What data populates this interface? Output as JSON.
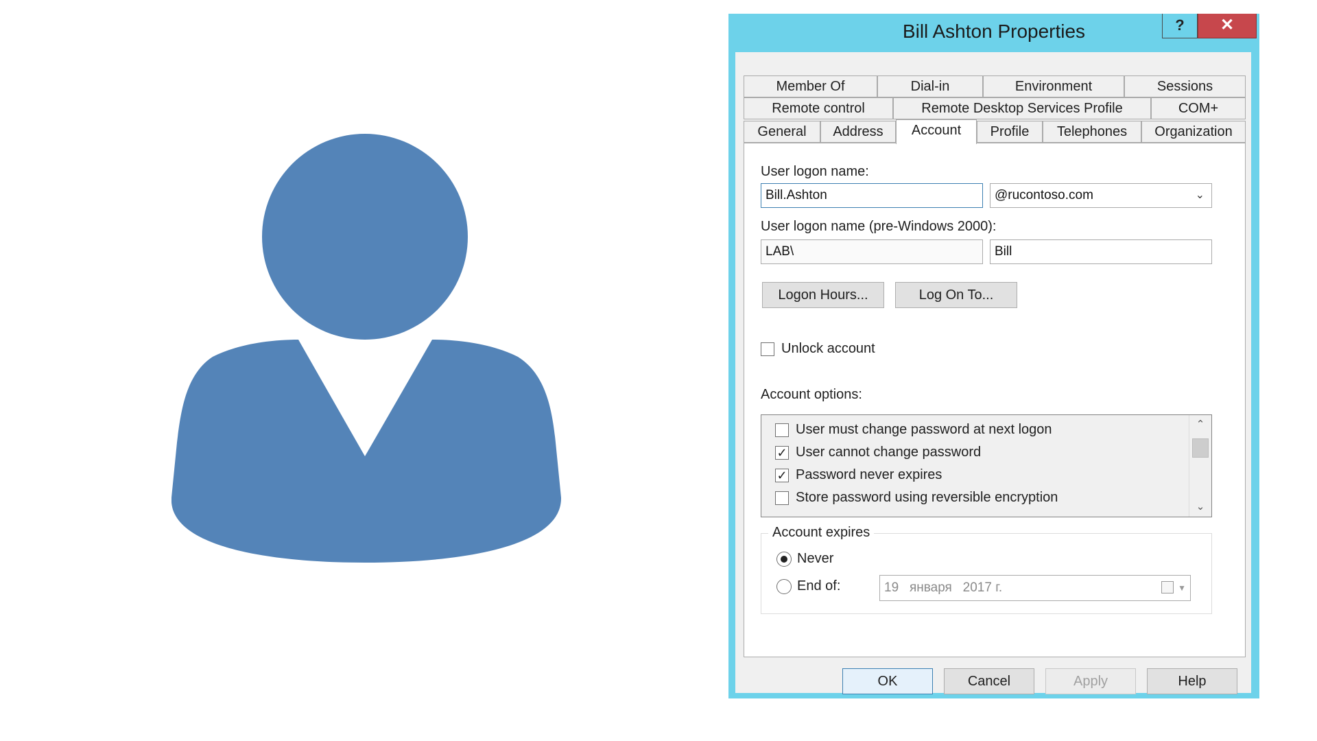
{
  "colors": {
    "avatar": "#5484b8",
    "titlebar": "#6dd2ea",
    "close": "#c7474c"
  },
  "window": {
    "title": "Bill Ashton Properties",
    "help_label": "?",
    "close_label": "✕"
  },
  "tabs": {
    "row1": [
      {
        "label": "Member Of"
      },
      {
        "label": "Dial-in"
      },
      {
        "label": "Environment"
      },
      {
        "label": "Sessions"
      }
    ],
    "row2": [
      {
        "label": "Remote control"
      },
      {
        "label": "Remote Desktop Services Profile"
      },
      {
        "label": "COM+"
      }
    ],
    "row3": [
      {
        "label": "General"
      },
      {
        "label": "Address"
      },
      {
        "label": "Account"
      },
      {
        "label": "Profile"
      },
      {
        "label": "Telephones"
      },
      {
        "label": "Organization"
      }
    ],
    "active": "Account"
  },
  "account": {
    "logon_name_label": "User logon name:",
    "logon_name_value": "Bill.Ashton",
    "domain_suffix": "@rucontoso.com",
    "pre2000_label": "User logon name (pre-Windows 2000):",
    "pre2000_domain": "LAB\\",
    "pre2000_user": "Bill",
    "logon_hours_button": "Logon Hours...",
    "log_on_to_button": "Log On To...",
    "unlock_label": "Unlock account",
    "unlock_checked": false,
    "options_label": "Account options:",
    "options": [
      {
        "label": "User must change password at next logon",
        "checked": false
      },
      {
        "label": "User cannot change password",
        "checked": true
      },
      {
        "label": "Password never expires",
        "checked": true
      },
      {
        "label": "Store password using reversible encryption",
        "checked": false
      }
    ],
    "expires_label": "Account expires",
    "never_label": "Never",
    "never_selected": true,
    "end_of_label": "End of:",
    "end_of_date": "19   января   2017 г."
  },
  "footer": {
    "ok": "OK",
    "cancel": "Cancel",
    "apply": "Apply",
    "help": "Help"
  }
}
